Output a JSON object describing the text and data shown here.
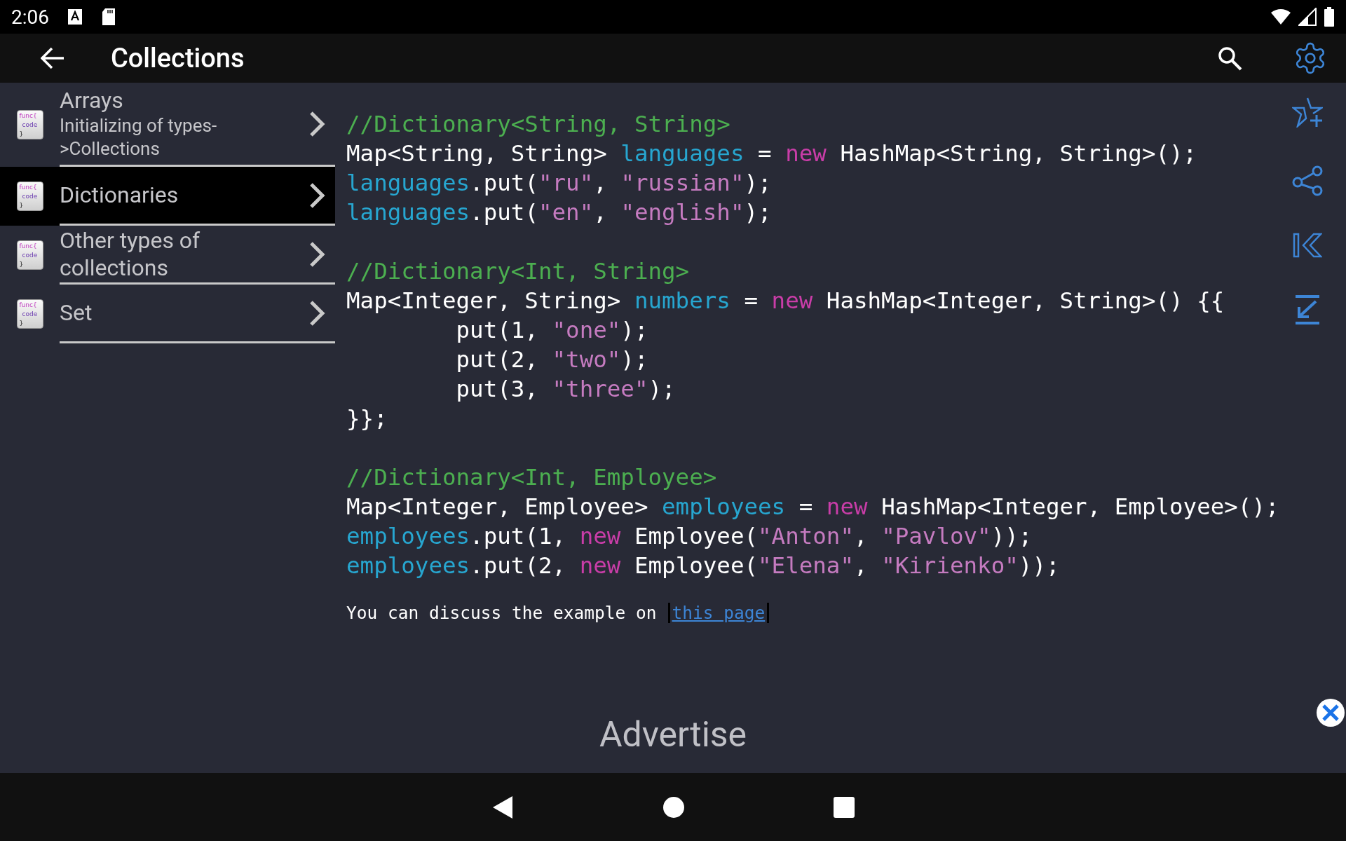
{
  "status_bar": {
    "time": "2:06"
  },
  "app_bar": {
    "title": "Collections"
  },
  "sidebar": {
    "items": [
      {
        "title": "Arrays",
        "subtitle": "Initializing of types->Collections",
        "icon_lines": [
          "func{",
          "code",
          "}"
        ],
        "selected": false
      },
      {
        "title": "Dictionaries",
        "icon_lines": [
          "func{",
          "code",
          "}"
        ],
        "selected": true
      },
      {
        "title": "Other types of collections",
        "icon_lines": [
          "func{",
          "code",
          "}"
        ],
        "selected": false
      },
      {
        "title": "Set",
        "icon_lines": [
          "func{",
          "code",
          "}"
        ],
        "selected": false
      }
    ]
  },
  "code": {
    "blocks": [
      [
        [
          {
            "kind": "comment",
            "text": "//Dictionary<String, String>"
          }
        ],
        [
          {
            "kind": "plain",
            "text": "Map<String, String> "
          },
          {
            "kind": "var",
            "text": "languages"
          },
          {
            "kind": "plain",
            "text": " = "
          },
          {
            "kind": "keyword",
            "text": "new"
          },
          {
            "kind": "plain",
            "text": " HashMap<String, String>();"
          }
        ],
        [
          {
            "kind": "var",
            "text": "languages"
          },
          {
            "kind": "plain",
            "text": ".put("
          },
          {
            "kind": "string",
            "text": "\"ru\""
          },
          {
            "kind": "plain",
            "text": ", "
          },
          {
            "kind": "string",
            "text": "\"russian\""
          },
          {
            "kind": "plain",
            "text": ");"
          }
        ],
        [
          {
            "kind": "var",
            "text": "languages"
          },
          {
            "kind": "plain",
            "text": ".put("
          },
          {
            "kind": "string",
            "text": "\"en\""
          },
          {
            "kind": "plain",
            "text": ", "
          },
          {
            "kind": "string",
            "text": "\"english\""
          },
          {
            "kind": "plain",
            "text": ");"
          }
        ]
      ],
      [
        [
          {
            "kind": "comment",
            "text": "//Dictionary<Int, String>"
          }
        ],
        [
          {
            "kind": "plain",
            "text": "Map<Integer, String> "
          },
          {
            "kind": "var",
            "text": "numbers"
          },
          {
            "kind": "plain",
            "text": " = "
          },
          {
            "kind": "keyword",
            "text": "new"
          },
          {
            "kind": "plain",
            "text": " HashMap<Integer, String>() {{"
          }
        ],
        [
          {
            "kind": "plain",
            "text": "        put(1, "
          },
          {
            "kind": "string",
            "text": "\"one\""
          },
          {
            "kind": "plain",
            "text": ");"
          }
        ],
        [
          {
            "kind": "plain",
            "text": "        put(2, "
          },
          {
            "kind": "string",
            "text": "\"two\""
          },
          {
            "kind": "plain",
            "text": ");"
          }
        ],
        [
          {
            "kind": "plain",
            "text": "        put(3, "
          },
          {
            "kind": "string",
            "text": "\"three\""
          },
          {
            "kind": "plain",
            "text": ");"
          }
        ],
        [
          {
            "kind": "plain",
            "text": "}};"
          }
        ]
      ],
      [
        [
          {
            "kind": "comment",
            "text": "//Dictionary<Int, Employee>"
          }
        ],
        [
          {
            "kind": "plain",
            "text": "Map<Integer, Employee> "
          },
          {
            "kind": "var",
            "text": "employees"
          },
          {
            "kind": "plain",
            "text": " = "
          },
          {
            "kind": "keyword",
            "text": "new"
          },
          {
            "kind": "plain",
            "text": " HashMap<Integer, Employee>();"
          }
        ],
        [
          {
            "kind": "var",
            "text": "employees"
          },
          {
            "kind": "plain",
            "text": ".put(1, "
          },
          {
            "kind": "keyword",
            "text": "new"
          },
          {
            "kind": "plain",
            "text": " Employee("
          },
          {
            "kind": "string",
            "text": "\"Anton\""
          },
          {
            "kind": "plain",
            "text": ", "
          },
          {
            "kind": "string",
            "text": "\"Pavlov\""
          },
          {
            "kind": "plain",
            "text": "));"
          }
        ],
        [
          {
            "kind": "var",
            "text": "employees"
          },
          {
            "kind": "plain",
            "text": ".put(2, "
          },
          {
            "kind": "keyword",
            "text": "new"
          },
          {
            "kind": "plain",
            "text": " Employee("
          },
          {
            "kind": "string",
            "text": "\"Elena\""
          },
          {
            "kind": "plain",
            "text": ", "
          },
          {
            "kind": "string",
            "text": "\"Kirienko\""
          },
          {
            "kind": "plain",
            "text": "));"
          }
        ]
      ]
    ],
    "discuss_text": "You can discuss the example on",
    "discuss_link": "this page"
  },
  "ad": {
    "label": "Advertise"
  }
}
